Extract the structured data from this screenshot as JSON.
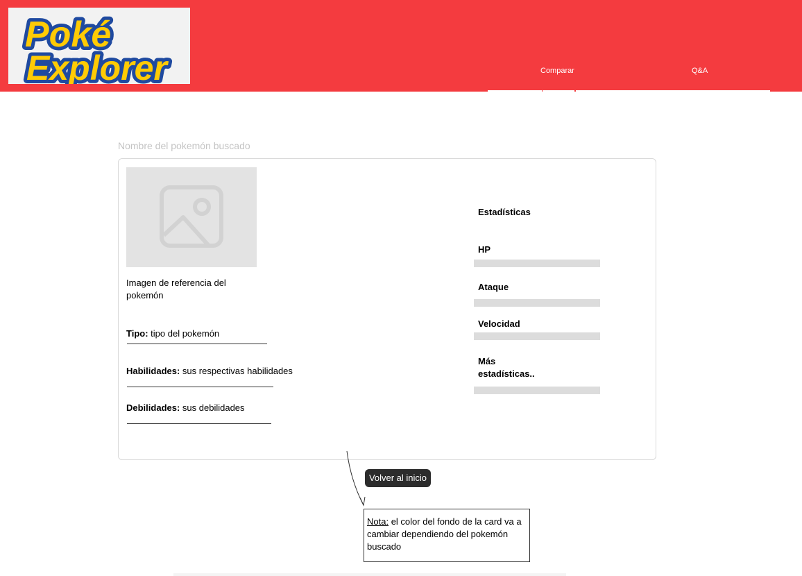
{
  "header": {
    "logo": {
      "line1": "Poké",
      "line2": "Explorer"
    },
    "nav": [
      {
        "label": "Comparar",
        "active": true
      },
      {
        "label": "Q&A",
        "active": false
      }
    ],
    "background_color": "#f43b3f"
  },
  "search": {
    "label": "Nombre del pokemón buscado"
  },
  "card": {
    "image_icon": "image-placeholder-icon",
    "image_caption": "Imagen de referencia del pokemón",
    "fields": [
      {
        "label": "Tipo:",
        "value": "tipo del pokemón"
      },
      {
        "label": "Habilidades:",
        "value": "sus respectivas habilidades"
      },
      {
        "label": "Debilidades:",
        "value": "sus debilidades"
      }
    ],
    "stats": {
      "title": "Estadísticas",
      "items": [
        {
          "label": "HP"
        },
        {
          "label": "Ataque"
        },
        {
          "label": "Velocidad"
        },
        {
          "label": "Más estadísticas.."
        }
      ]
    }
  },
  "back_button": {
    "label": "Volver al inicio"
  },
  "note": {
    "label": "Nota:",
    "text": " el color del fondo de la card va a cambiar dependiendo del pokemón buscado"
  }
}
